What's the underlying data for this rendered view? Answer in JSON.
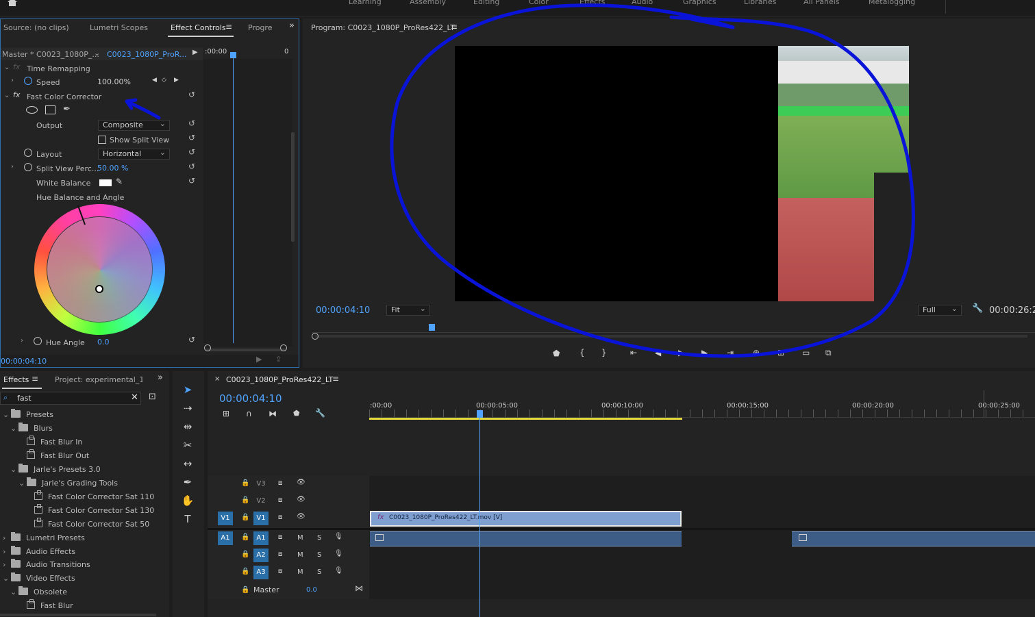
{
  "workspaces": [
    "Learning",
    "Assembly",
    "Editing",
    "Color",
    "Effects",
    "Audio",
    "Graphics",
    "Libraries",
    "All Panels",
    "Metalogging"
  ],
  "source_panel": {
    "tabs": [
      "Source: (no clips)",
      "Lumetri Scopes",
      "Effect Controls",
      "Progres"
    ],
    "master_label": "Master * C0023_1080P_...",
    "clip_label": "C0023_1080P_ProR...",
    "ruler_start": ":00:00",
    "timecode": "00:00:04:10",
    "properties": {
      "time_remapping": "Time Remapping",
      "speed_label": "Speed",
      "speed_value": "100.00%",
      "fcc": "Fast Color Corrector",
      "output_label": "Output",
      "output_value": "Composite",
      "show_split_view": "Show Split View",
      "layout_label": "Layout",
      "layout_value": "Horizontal",
      "split_label": "Split View Perc...",
      "split_value": "50.00 %",
      "wb_label": "White Balance",
      "hue_balance": "Hue Balance and Angle",
      "hue_angle_label": "Hue Angle",
      "hue_angle_value": "0.0"
    }
  },
  "program": {
    "title": "Program: C0023_1080P_ProRes422_LT",
    "timecode": "00:00:04:10",
    "fit": "Fit",
    "quality": "Full",
    "duration": "00:00:26:2"
  },
  "effects_panel": {
    "tabs": [
      "Effects",
      "Project: experimental_1_"
    ],
    "search_value": "fast",
    "tree": [
      {
        "label": "Presets",
        "indent": 0,
        "kind": "folder",
        "open": true
      },
      {
        "label": "Blurs",
        "indent": 1,
        "kind": "folder",
        "open": true
      },
      {
        "label": "Fast Blur In",
        "indent": 2,
        "kind": "preset"
      },
      {
        "label": "Fast Blur Out",
        "indent": 2,
        "kind": "preset"
      },
      {
        "label": "Jarle's Presets 3.0",
        "indent": 1,
        "kind": "folder",
        "open": true
      },
      {
        "label": "Jarle's Grading Tools",
        "indent": 2,
        "kind": "folder",
        "open": true
      },
      {
        "label": "Fast Color Corrector Sat 110",
        "indent": 3,
        "kind": "preset"
      },
      {
        "label": "Fast Color Corrector Sat 130",
        "indent": 3,
        "kind": "preset"
      },
      {
        "label": "Fast Color Corrector Sat 50",
        "indent": 3,
        "kind": "preset"
      },
      {
        "label": "Lumetri Presets",
        "indent": 0,
        "kind": "folder",
        "open": false
      },
      {
        "label": "Audio Effects",
        "indent": 0,
        "kind": "folder",
        "open": false
      },
      {
        "label": "Audio Transitions",
        "indent": 0,
        "kind": "folder",
        "open": false
      },
      {
        "label": "Video Effects",
        "indent": 0,
        "kind": "folder",
        "open": true
      },
      {
        "label": "Obsolete",
        "indent": 1,
        "kind": "folder",
        "open": true
      },
      {
        "label": "Fast Blur",
        "indent": 2,
        "kind": "preset"
      }
    ]
  },
  "timeline": {
    "sequence_name": "C0023_1080P_ProRes422_LT",
    "timecode": "00:00:04:10",
    "ruler": [
      ":00:00",
      "00:00:05:00",
      "00:00:10:00",
      "00:00:15:00",
      "00:00:20:00",
      "00:00:25:00"
    ],
    "tracks": {
      "video": [
        "V3",
        "V2",
        "V1"
      ],
      "audio": [
        "A1",
        "A2",
        "A3"
      ],
      "source_v": "V1",
      "source_a": "A1",
      "master_label": "Master",
      "master_value": "0.0",
      "mute": "M",
      "solo": "S"
    },
    "clip_name": "C0023_1080P_ProRes422_LT.mov [V]"
  },
  "colors": {
    "accent_blue": "#4fa3ff",
    "track_blue": "#2a6fa8",
    "clip_blue": "#7f9fd0",
    "annotation": "#0a14d8",
    "work_area": "#e2d83a"
  }
}
